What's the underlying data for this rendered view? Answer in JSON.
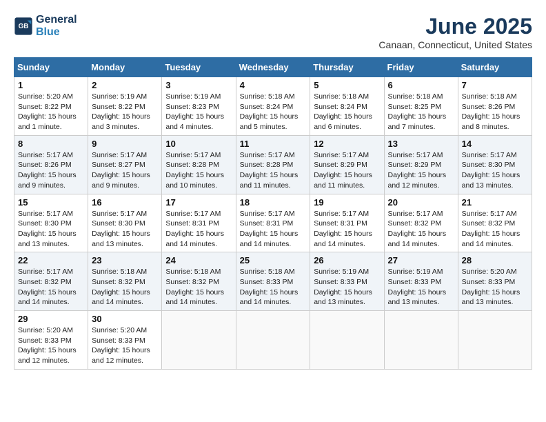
{
  "logo": {
    "line1": "General",
    "line2": "Blue"
  },
  "title": "June 2025",
  "location": "Canaan, Connecticut, United States",
  "days_of_week": [
    "Sunday",
    "Monday",
    "Tuesday",
    "Wednesday",
    "Thursday",
    "Friday",
    "Saturday"
  ],
  "weeks": [
    [
      {
        "day": "1",
        "sunrise": "5:20 AM",
        "sunset": "8:22 PM",
        "daylight": "15 hours and 1 minute."
      },
      {
        "day": "2",
        "sunrise": "5:19 AM",
        "sunset": "8:22 PM",
        "daylight": "15 hours and 3 minutes."
      },
      {
        "day": "3",
        "sunrise": "5:19 AM",
        "sunset": "8:23 PM",
        "daylight": "15 hours and 4 minutes."
      },
      {
        "day": "4",
        "sunrise": "5:18 AM",
        "sunset": "8:24 PM",
        "daylight": "15 hours and 5 minutes."
      },
      {
        "day": "5",
        "sunrise": "5:18 AM",
        "sunset": "8:24 PM",
        "daylight": "15 hours and 6 minutes."
      },
      {
        "day": "6",
        "sunrise": "5:18 AM",
        "sunset": "8:25 PM",
        "daylight": "15 hours and 7 minutes."
      },
      {
        "day": "7",
        "sunrise": "5:18 AM",
        "sunset": "8:26 PM",
        "daylight": "15 hours and 8 minutes."
      }
    ],
    [
      {
        "day": "8",
        "sunrise": "5:17 AM",
        "sunset": "8:26 PM",
        "daylight": "15 hours and 9 minutes."
      },
      {
        "day": "9",
        "sunrise": "5:17 AM",
        "sunset": "8:27 PM",
        "daylight": "15 hours and 9 minutes."
      },
      {
        "day": "10",
        "sunrise": "5:17 AM",
        "sunset": "8:28 PM",
        "daylight": "15 hours and 10 minutes."
      },
      {
        "day": "11",
        "sunrise": "5:17 AM",
        "sunset": "8:28 PM",
        "daylight": "15 hours and 11 minutes."
      },
      {
        "day": "12",
        "sunrise": "5:17 AM",
        "sunset": "8:29 PM",
        "daylight": "15 hours and 11 minutes."
      },
      {
        "day": "13",
        "sunrise": "5:17 AM",
        "sunset": "8:29 PM",
        "daylight": "15 hours and 12 minutes."
      },
      {
        "day": "14",
        "sunrise": "5:17 AM",
        "sunset": "8:30 PM",
        "daylight": "15 hours and 13 minutes."
      }
    ],
    [
      {
        "day": "15",
        "sunrise": "5:17 AM",
        "sunset": "8:30 PM",
        "daylight": "15 hours and 13 minutes."
      },
      {
        "day": "16",
        "sunrise": "5:17 AM",
        "sunset": "8:30 PM",
        "daylight": "15 hours and 13 minutes."
      },
      {
        "day": "17",
        "sunrise": "5:17 AM",
        "sunset": "8:31 PM",
        "daylight": "15 hours and 14 minutes."
      },
      {
        "day": "18",
        "sunrise": "5:17 AM",
        "sunset": "8:31 PM",
        "daylight": "15 hours and 14 minutes."
      },
      {
        "day": "19",
        "sunrise": "5:17 AM",
        "sunset": "8:31 PM",
        "daylight": "15 hours and 14 minutes."
      },
      {
        "day": "20",
        "sunrise": "5:17 AM",
        "sunset": "8:32 PM",
        "daylight": "15 hours and 14 minutes."
      },
      {
        "day": "21",
        "sunrise": "5:17 AM",
        "sunset": "8:32 PM",
        "daylight": "15 hours and 14 minutes."
      }
    ],
    [
      {
        "day": "22",
        "sunrise": "5:17 AM",
        "sunset": "8:32 PM",
        "daylight": "15 hours and 14 minutes."
      },
      {
        "day": "23",
        "sunrise": "5:18 AM",
        "sunset": "8:32 PM",
        "daylight": "15 hours and 14 minutes."
      },
      {
        "day": "24",
        "sunrise": "5:18 AM",
        "sunset": "8:32 PM",
        "daylight": "15 hours and 14 minutes."
      },
      {
        "day": "25",
        "sunrise": "5:18 AM",
        "sunset": "8:33 PM",
        "daylight": "15 hours and 14 minutes."
      },
      {
        "day": "26",
        "sunrise": "5:19 AM",
        "sunset": "8:33 PM",
        "daylight": "15 hours and 13 minutes."
      },
      {
        "day": "27",
        "sunrise": "5:19 AM",
        "sunset": "8:33 PM",
        "daylight": "15 hours and 13 minutes."
      },
      {
        "day": "28",
        "sunrise": "5:20 AM",
        "sunset": "8:33 PM",
        "daylight": "15 hours and 13 minutes."
      }
    ],
    [
      {
        "day": "29",
        "sunrise": "5:20 AM",
        "sunset": "8:33 PM",
        "daylight": "15 hours and 12 minutes."
      },
      {
        "day": "30",
        "sunrise": "5:20 AM",
        "sunset": "8:33 PM",
        "daylight": "15 hours and 12 minutes."
      },
      null,
      null,
      null,
      null,
      null
    ]
  ],
  "labels": {
    "sunrise": "Sunrise: ",
    "sunset": "Sunset: ",
    "daylight": "Daylight: "
  }
}
